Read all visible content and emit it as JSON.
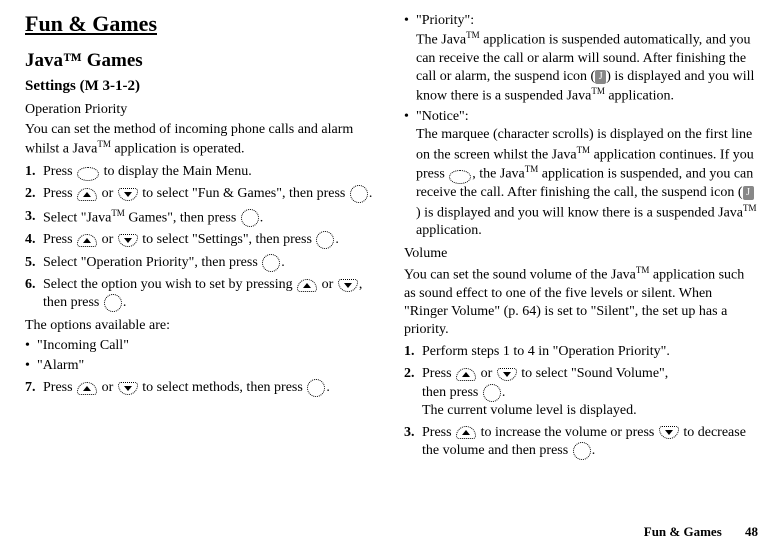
{
  "h1": "Fun & Games",
  "h2": "Java™ Games",
  "h3": "Settings (M 3-1-2)",
  "op_priority_head": "Operation Priority",
  "op_priority_intro_a": "You can set the method of incoming phone calls and alarm whilst a Java",
  "op_priority_intro_b": " application is operated.",
  "tm": "TM",
  "steps_left": {
    "s1_a": "Press ",
    "s1_b": " to display the Main Menu.",
    "s2_a": "Press ",
    "s2_b": " or ",
    "s2_c": " to select \"Fun & Games\", then press ",
    "s2_d": ".",
    "s3_a": "Select \"Java",
    "s3_b": " Games\", then press ",
    "s3_c": ".",
    "s4_a": "Press ",
    "s4_b": " or ",
    "s4_c": " to select \"Settings\", then press ",
    "s4_d": ".",
    "s5_a": "Select \"Operation Priority\", then press ",
    "s5_b": ".",
    "s6_a": "Select the option you wish to set by pressing ",
    "s6_b": " or ",
    "s6_c": ", then press ",
    "s6_d": ".",
    "opts_intro": "The options available are:",
    "opt1": "\"Incoming Call\"",
    "opt2": "\"Alarm\"",
    "s7_a": "Press ",
    "s7_b": " or ",
    "s7_c": " to select methods, then press ",
    "s7_d": "."
  },
  "right": {
    "prio_label": "\"Priority\":",
    "prio_a": "The Java",
    "prio_b": " application is suspended automatically, and you can receive the call or alarm will sound. After finishing the call or alarm, the suspend icon (",
    "prio_c": ") is displayed and you will know there is a suspended Java",
    "prio_d": " application.",
    "notice_label": "\"Notice\":",
    "notice_a": "The marquee (character scrolls) is displayed on the first line on the screen whilst the Java",
    "notice_b": " application continues. If you press ",
    "notice_c": ", the Java",
    "notice_d": " application is suspended, and you can receive the call. After finishing the call, the suspend icon (",
    "notice_e": ") is displayed and you will know there is a suspended Java",
    "notice_f": " application.",
    "vol_head": "Volume",
    "vol_intro_a": "You can set the sound volume of the Java",
    "vol_intro_b": " application such as sound effect to one of the five levels or silent. When \"Ringer Volume\" (p. 64) is set to \"Silent\", the set up has a priority.",
    "v1": "Perform steps 1 to 4 in \"Operation Priority\".",
    "v2_a": "Press ",
    "v2_b": " or ",
    "v2_c": " to select \"Sound Volume\",",
    "v2_d": "then press ",
    "v2_e": ".",
    "v2_f": "The current volume level is displayed.",
    "v3_a": "Press ",
    "v3_b": " to increase the volume or press ",
    "v3_c": " to decrease the volume and then press ",
    "v3_d": "."
  },
  "footer_title": "Fun & Games",
  "footer_page": "48"
}
